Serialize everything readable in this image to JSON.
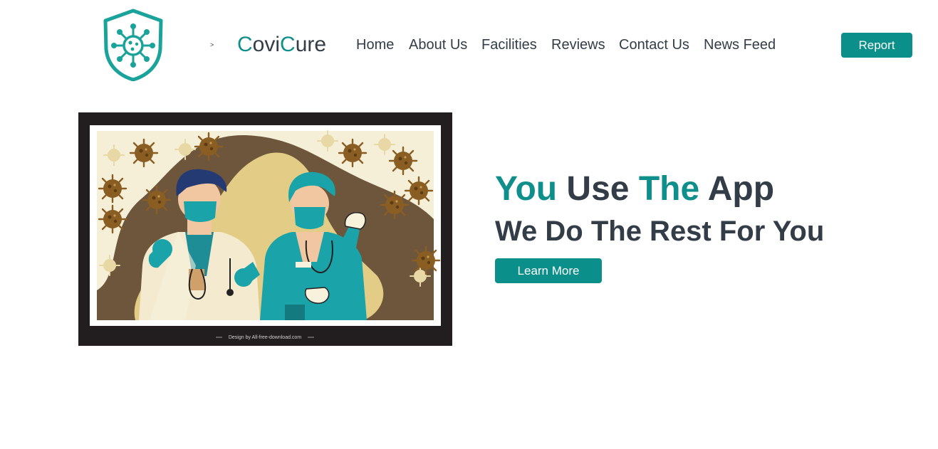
{
  "nav": {
    "logo_icon": "virus-shield-icon",
    "toggler": ">",
    "brand": {
      "c1": "C",
      "ovi": "ovi",
      "c2": "C",
      "ure": "ure"
    },
    "links": [
      "Home",
      "About Us",
      "Facilities",
      "Reviews",
      "Contact Us",
      "News Feed"
    ],
    "report_label": "Report"
  },
  "hero": {
    "image_credit": "Design by All-free-download.com",
    "headline": {
      "w1": "You",
      "w2": " Use ",
      "w3": "The",
      "w4": " App"
    },
    "subline": "We Do The Rest For You",
    "cta_label": "Learn More"
  },
  "colors": {
    "accent": "#0a8f8a",
    "text": "#333d47",
    "image_frame": "#221e1f",
    "image_bg": "#f5efd8",
    "blob_brown": "#6e563c",
    "blob_yellow": "#e3cd86",
    "virus": "#8a5d23"
  }
}
